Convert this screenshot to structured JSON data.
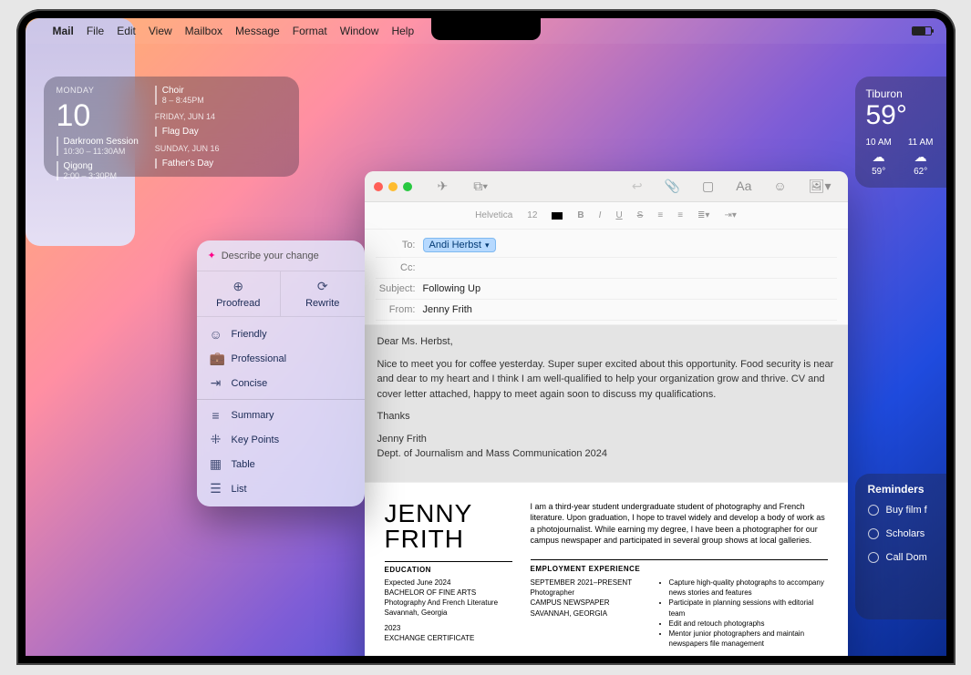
{
  "menubar": {
    "app": "Mail",
    "items": [
      "File",
      "Edit",
      "View",
      "Mailbox",
      "Message",
      "Format",
      "Window",
      "Help"
    ]
  },
  "cal_widget": {
    "day": "MONDAY",
    "date": "10",
    "events_left": [
      {
        "title": "Darkroom Session",
        "time": "10:30 – 11:30AM"
      },
      {
        "title": "Qigong",
        "time": "2:00 – 3:30PM"
      }
    ],
    "events_right": [
      {
        "title": "Choir",
        "time": "8 – 8:45PM"
      },
      {
        "head": "FRIDAY, JUN 14",
        "title": "Flag Day"
      },
      {
        "head": "SUNDAY, JUN 16",
        "title": "Father's Day"
      }
    ]
  },
  "weather": {
    "loc": "Tiburon",
    "temp": "59°",
    "hours": [
      {
        "t": "10 AM",
        "ico": "☁︎",
        "deg": "59°"
      },
      {
        "t": "11 AM",
        "ico": "☁︎",
        "deg": "62°"
      }
    ]
  },
  "reminders": {
    "title": "Reminders",
    "items": [
      "Buy film f",
      "Scholars",
      "Call Dom"
    ]
  },
  "writing_tools": {
    "prompt": "Describe your change",
    "primary": [
      {
        "ico": "⊕",
        "label": "Proofread"
      },
      {
        "ico": "⟳",
        "label": "Rewrite"
      }
    ],
    "styles": [
      {
        "ico": "☺",
        "label": "Friendly"
      },
      {
        "ico": "💼",
        "label": "Professional"
      },
      {
        "ico": "⇥",
        "label": "Concise"
      }
    ],
    "transforms": [
      {
        "ico": "≡",
        "label": "Summary"
      },
      {
        "ico": "⁜",
        "label": "Key Points"
      },
      {
        "ico": "▦",
        "label": "Table"
      },
      {
        "ico": "☰",
        "label": "List"
      }
    ]
  },
  "compose": {
    "toolbar": {
      "font": "Helvetica",
      "size": "12"
    },
    "to_label": "To:",
    "to_chip": "Andi Herbst",
    "cc_label": "Cc:",
    "subject_label": "Subject:",
    "subject": "Following Up",
    "from_label": "From:",
    "from": "Jenny Frith",
    "body": {
      "greeting": "Dear Ms. Herbst,",
      "p1": "Nice to meet you for coffee yesterday. Super super excited about this opportunity. Food security is near and dear to my heart and I think I am well-qualified to help your organization grow and thrive. CV and cover letter attached, happy to meet again soon to discuss my qualifications.",
      "thanks": "Thanks",
      "sig1": "Jenny Frith",
      "sig2": "Dept. of Journalism and Mass Communication 2024"
    },
    "resume": {
      "name1": "JENNY",
      "name2": "FRITH",
      "intro": "I am a third-year student undergraduate student of photography and French literature. Upon graduation, I hope to travel widely and develop a body of work as a photojournalist. While earning my degree, I have been a photographer for our campus newspaper and participated in several group shows at local galleries.",
      "edu_head": "EDUCATION",
      "edu1": "Expected June 2024",
      "edu2": "BACHELOR OF FINE ARTS",
      "edu3": "Photography and French Literature",
      "edu4": "Savannah, Georgia",
      "edu5": "2023",
      "edu6": "EXCHANGE CERTIFICATE",
      "exp_head": "EMPLOYMENT EXPERIENCE",
      "exp_l1": "SEPTEMBER 2021–PRESENT",
      "exp_l2": "Photographer",
      "exp_l3": "CAMPUS NEWSPAPER",
      "exp_l4": "SAVANNAH, GEORGIA",
      "exp_b1": "Capture high-quality photographs to accompany news stories and features",
      "exp_b2": "Participate in planning sessions with editorial team",
      "exp_b3": "Edit and retouch photographs",
      "exp_b4": "Mentor junior photographers and maintain newspapers file management"
    }
  }
}
